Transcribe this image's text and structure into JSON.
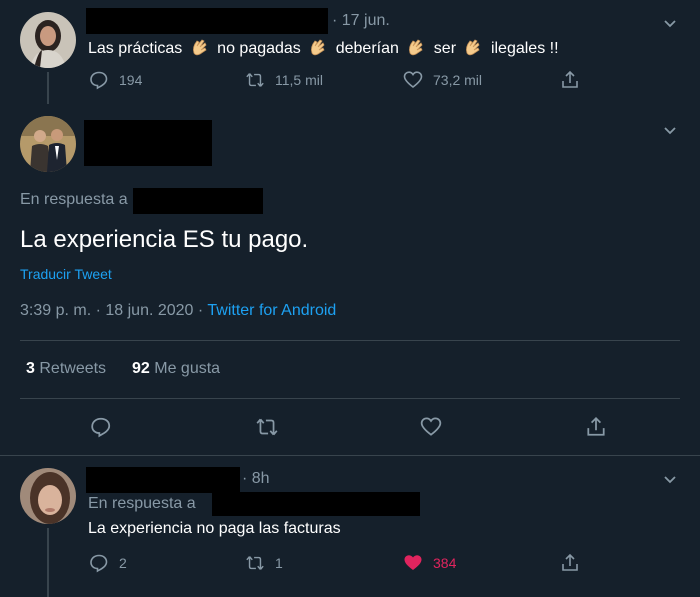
{
  "tweet1": {
    "date": "· 17 jun.",
    "text_parts": [
      "Las prácticas",
      "no pagadas",
      "deberían",
      "ser",
      "ilegales !!"
    ],
    "clap_icon": "clapping-hands-icon",
    "reply_count": "194",
    "retweet_count": "11,5 mil",
    "like_count": "73,2 mil"
  },
  "tweet2": {
    "reply_to_label": "En respuesta a",
    "text": "La experiencia ES tu pago.",
    "translate": "Traducir Tweet",
    "time": "3:39 p. m. · 18 jun. 2020 · ",
    "source": "Twitter for Android",
    "retweets_num": "3",
    "retweets_label": "Retweets",
    "likes_num": "92",
    "likes_label": "Me gusta"
  },
  "tweet3": {
    "time": "· 8h",
    "reply_to_label": "En respuesta a",
    "text": "La experiencia no paga las facturas",
    "reply_count": "2",
    "retweet_count": "1",
    "like_count": "384"
  },
  "colors": {
    "background": "#15202b",
    "muted": "#8899a6",
    "link": "#1da1f2",
    "like_active": "#e0245e",
    "divider": "#38444d"
  }
}
